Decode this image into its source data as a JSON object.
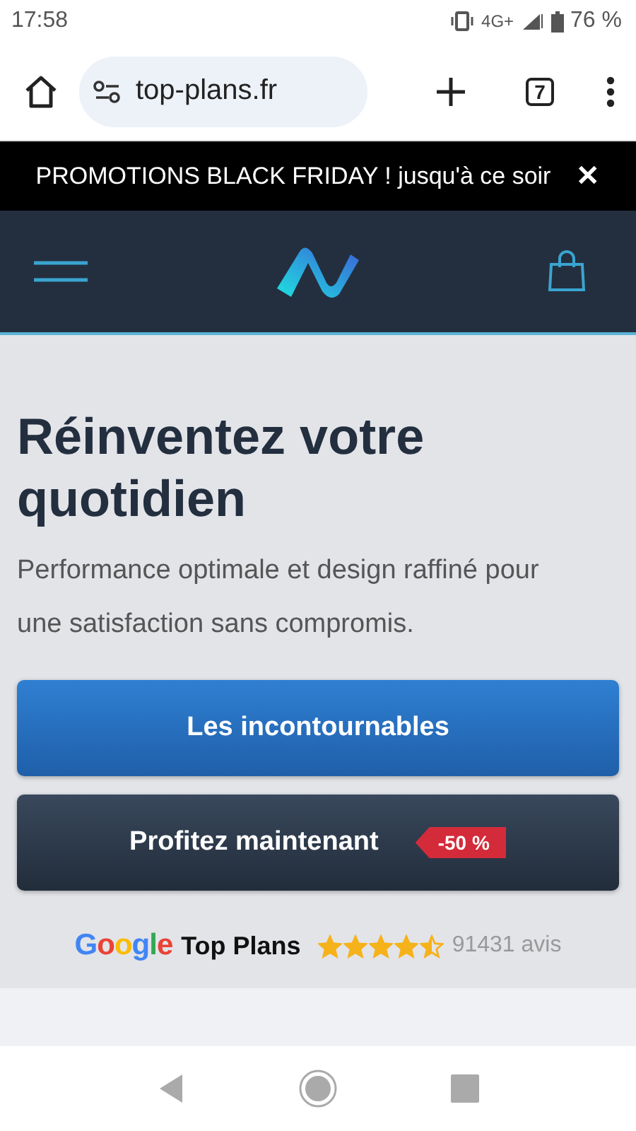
{
  "status_bar": {
    "time": "17:58",
    "network": "4G+",
    "battery": "76 %"
  },
  "browser": {
    "url": "top-plans.fr",
    "tab_count": "7"
  },
  "promo_banner": {
    "text": "PROMOTIONS BLACK FRIDAY ! jusqu'à ce soir",
    "close": "✕"
  },
  "hero": {
    "title": "Réinventez votre quotidien",
    "subtitle": "Performance optimale et design raffiné pour une satisfaction sans compromis.",
    "buttons": [
      {
        "label": "Les incontournables",
        "kind": "primary"
      },
      {
        "label": "Profitez maintenant",
        "kind": "dark",
        "badge": "-50 %"
      }
    ],
    "rating": {
      "source": "Google",
      "brand": "Top Plans",
      "stars": 4.5,
      "count": "91431 avis"
    }
  }
}
